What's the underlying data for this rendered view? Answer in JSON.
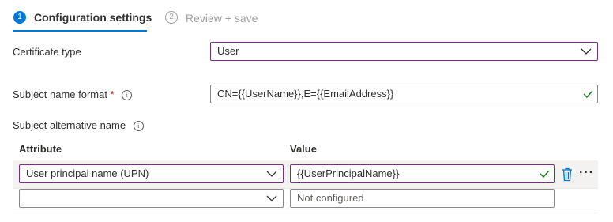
{
  "wizard": {
    "steps": [
      {
        "number": "1",
        "label": "Configuration settings"
      },
      {
        "number": "2",
        "label": "Review + save"
      }
    ]
  },
  "form": {
    "certificate_type": {
      "label": "Certificate type",
      "value": "User"
    },
    "subject_name_format": {
      "label": "Subject name format",
      "required_mark": "*",
      "value": "CN={{UserName}},E={{EmailAddress}}"
    },
    "subject_alternative_name": {
      "label": "Subject alternative name"
    }
  },
  "san_table": {
    "headers": {
      "attribute": "Attribute",
      "value": "Value"
    },
    "rows": [
      {
        "attribute": "User principal name (UPN)",
        "value": "{{UserPrincipalName}}"
      },
      {
        "attribute": "",
        "value_placeholder": "Not configured"
      }
    ]
  },
  "icons": {
    "info": "info-icon",
    "chevron": "chevron-down-icon",
    "check": "check-icon",
    "delete": "trash-icon",
    "more": "more-icon"
  },
  "colors": {
    "accent": "#0078d4",
    "focus_border": "#7b2a8e",
    "check": "#107c10",
    "required": "#a4262c"
  }
}
